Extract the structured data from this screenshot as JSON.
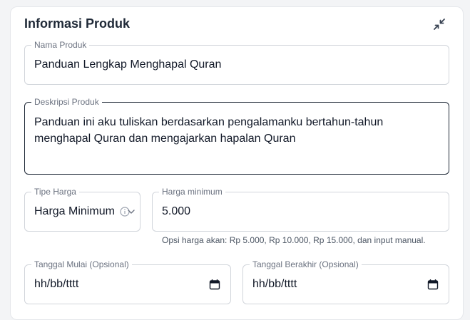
{
  "card": {
    "title": "Informasi Produk",
    "collapse_icon": "collapse-arrows-icon"
  },
  "product_name": {
    "label": "Nama Produk",
    "value": "Panduan Lengkap Menghapal Quran"
  },
  "product_description": {
    "label": "Deskripsi Produk",
    "value": "Panduan ini aku tuliskan berdasarkan pengalamanku bertahun-tahun menghapal Quran dan mengajarkan hapalan Quran"
  },
  "price_type": {
    "label": "Tipe Harga",
    "selected": "Harga Minimum",
    "info_icon": "info-icon",
    "chevron_icon": "chevron-down-icon"
  },
  "min_price": {
    "label": "Harga minimum",
    "value": "5.000",
    "helper": "Opsi harga akan: Rp 5.000, Rp 10.000, Rp 15.000, dan input manual."
  },
  "start_date": {
    "label": "Tanggal Mulai (Opsional)",
    "placeholder": "hh/bb/tttt",
    "icon": "calendar-icon"
  },
  "end_date": {
    "label": "Tanggal Berakhir (Opsional)",
    "placeholder": "hh/bb/tttt",
    "icon": "calendar-icon"
  },
  "colors": {
    "focused_border": "#1f2937",
    "default_border": "#d1d5db",
    "label": "#6b7280"
  }
}
